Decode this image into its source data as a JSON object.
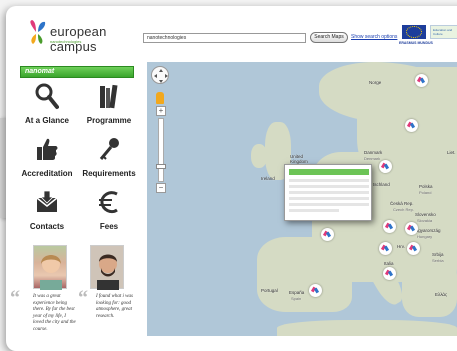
{
  "header": {
    "brand": "european campus",
    "brand_sub": "nanotechnologies",
    "search_value": "nanotechnologies",
    "search_button": "Search Maps",
    "search_options": "Show search options",
    "erasmus": "ERASMUS MUNDUS",
    "partner": "Education and Culture"
  },
  "sidebar": {
    "program_banner": "nanomat",
    "items": [
      {
        "label": "At a Glance",
        "icon": "magnifier-icon"
      },
      {
        "label": "Programme",
        "icon": "books-icon"
      },
      {
        "label": "Accreditation",
        "icon": "thumbs-up-icon"
      },
      {
        "label": "Requirements",
        "icon": "key-icon"
      },
      {
        "label": "Contacts",
        "icon": "envelope-icon"
      },
      {
        "label": "Fees",
        "icon": "euro-icon"
      }
    ],
    "testimonials": [
      {
        "quote": "It was a great experience being there. By far the best year of my life, I loved the city and the course."
      },
      {
        "quote": "I found what i was looking for: good atmosphere, great research."
      }
    ]
  },
  "map": {
    "places": [
      {
        "name": "Norge"
      },
      {
        "name": "Danmark"
      },
      {
        "name": "Denmark"
      },
      {
        "name": "United Kingdom"
      },
      {
        "name": "Ireland"
      },
      {
        "name": "Polska"
      },
      {
        "name": "Poland"
      },
      {
        "name": "Česká Rep."
      },
      {
        "name": "Czech Rep."
      },
      {
        "name": "Slovensko"
      },
      {
        "name": "Slovakia"
      },
      {
        "name": "Magyarország"
      },
      {
        "name": "Hungary"
      },
      {
        "name": "Hrv."
      },
      {
        "name": "Srbija"
      },
      {
        "name": "Serbia"
      },
      {
        "name": "Italia"
      },
      {
        "name": "Italy"
      },
      {
        "name": "España"
      },
      {
        "name": "Spain"
      },
      {
        "name": "Portugal"
      },
      {
        "name": "tschland"
      },
      {
        "name": "Ελλάς"
      },
      {
        "name": "Liet."
      }
    ]
  },
  "colors": {
    "banner_green": "#3aa52c",
    "water": "#b0c7d8",
    "land": "#d5dbc4",
    "link": "#1a3fb0"
  }
}
